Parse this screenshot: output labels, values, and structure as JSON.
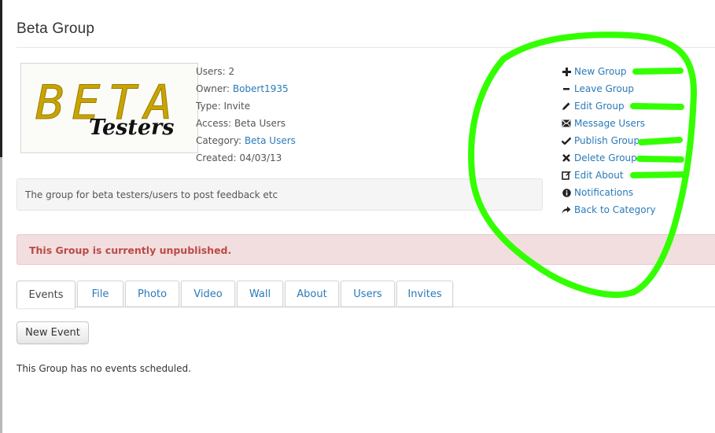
{
  "page": {
    "title": "Beta Group"
  },
  "logo": {
    "line1": "BETA",
    "line2": "Testers"
  },
  "info": {
    "users_label": "Users:",
    "users_value": "2",
    "owner_label": "Owner:",
    "owner_value": "Bobert1935",
    "type_label": "Type:",
    "type_value": "Invite",
    "access_label": "Access:",
    "access_value": "Beta Users",
    "category_label": "Category:",
    "category_value": "Beta Users",
    "created_label": "Created:",
    "created_value": "04/03/13"
  },
  "description": "The group for beta testers/users to post feedback etc",
  "actions": [
    {
      "label": "New Group",
      "icon": "plus-icon"
    },
    {
      "label": "Leave Group",
      "icon": "minus-icon"
    },
    {
      "label": "Edit Group",
      "icon": "pencil-icon"
    },
    {
      "label": "Message Users",
      "icon": "envelope-icon"
    },
    {
      "label": "Publish Group",
      "icon": "checkmark-icon"
    },
    {
      "label": "Delete Group",
      "icon": "x-icon"
    },
    {
      "label": "Edit About",
      "icon": "edit-box-icon"
    },
    {
      "label": "Notifications",
      "icon": "info-circle-icon"
    },
    {
      "label": "Back to Category",
      "icon": "share-arrow-icon"
    }
  ],
  "alert": {
    "text": "This Group is currently unpublished."
  },
  "tabs": [
    {
      "label": "Events",
      "active": true
    },
    {
      "label": "File"
    },
    {
      "label": "Photo"
    },
    {
      "label": "Video"
    },
    {
      "label": "Wall"
    },
    {
      "label": "About"
    },
    {
      "label": "Users"
    },
    {
      "label": "Invites"
    }
  ],
  "content": {
    "new_event_label": "New Event",
    "empty_message": "This Group has no events scheduled."
  },
  "colors": {
    "link": "#2a7ab8",
    "alert_bg": "#f2dede",
    "alert_text": "#b94a48",
    "annotation": "#33ff00",
    "logo_beta": "#c9a400"
  }
}
